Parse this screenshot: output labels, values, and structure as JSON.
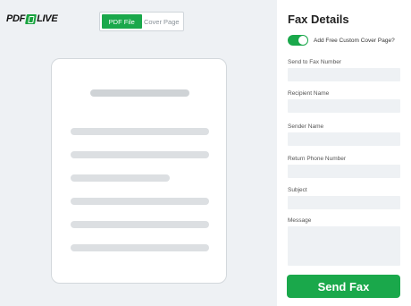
{
  "logo": {
    "left_text": "PDF",
    "right_text": "LIVE"
  },
  "toggle": {
    "pdf_file": "PDF File",
    "cover_page": "Cover Page"
  },
  "panel": {
    "title": "Fax Details",
    "cover_toggle_label": "Add Free Custom Cover Page?",
    "fields": {
      "fax_number": "Send to Fax Number",
      "recipient": "Recipient Name",
      "sender": "Sender Name",
      "return_phone": "Return Phone Number",
      "subject": "Subject",
      "message": "Message"
    },
    "send_label": "Send Fax"
  },
  "colors": {
    "accent": "#1aa84b",
    "background": "#eef1f4"
  }
}
